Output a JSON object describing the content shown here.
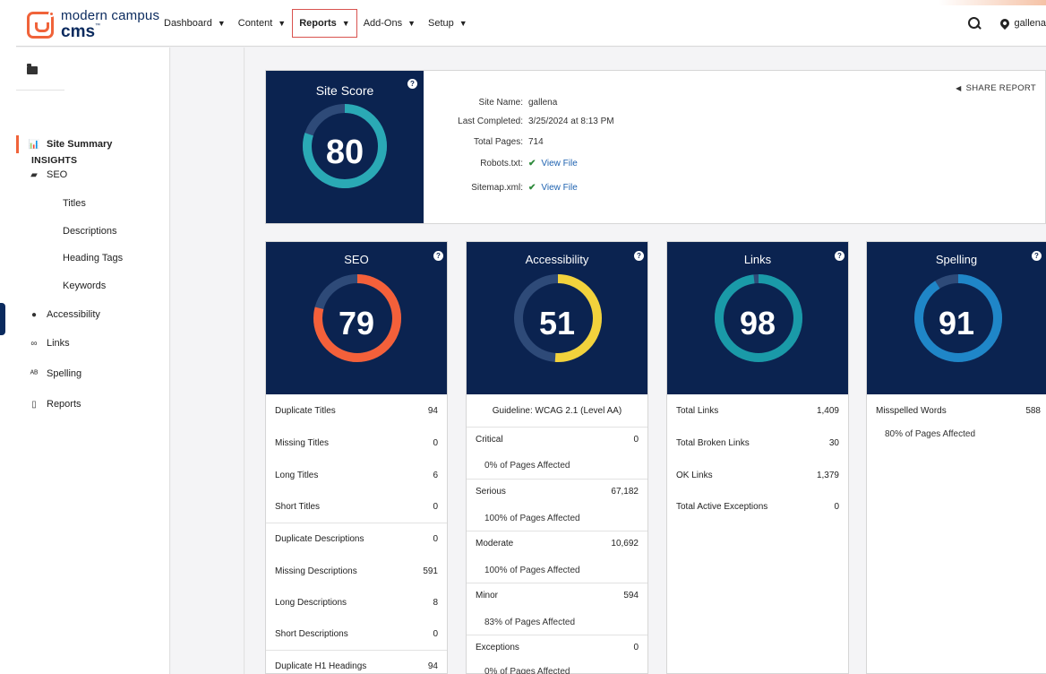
{
  "app": {
    "logo_line1": "modern campus",
    "logo_line2": "cms",
    "logo_tm": "™"
  },
  "nav": [
    {
      "label": "Dashboard",
      "active": false
    },
    {
      "label": "Content",
      "active": false
    },
    {
      "label": "Reports",
      "active": true
    },
    {
      "label": "Add-Ons",
      "active": false
    },
    {
      "label": "Setup",
      "active": false
    }
  ],
  "user": {
    "site": "gallena"
  },
  "sidebar": {
    "heading": "INSIGHTS",
    "items": [
      {
        "label": "Site Summary",
        "icon": "bar-chart-icon",
        "active": true
      },
      {
        "label": "SEO",
        "icon": "seo-icon",
        "active": false
      },
      {
        "label": "Accessibility",
        "icon": "accessibility-icon",
        "active": false
      },
      {
        "label": "Links",
        "icon": "link-icon",
        "active": false
      },
      {
        "label": "Spelling",
        "icon": "spelling-icon",
        "active": false
      },
      {
        "label": "Reports",
        "icon": "document-icon",
        "active": false
      }
    ],
    "seo_subitems": [
      "Titles",
      "Descriptions",
      "Heading Tags",
      "Keywords"
    ]
  },
  "site_score": {
    "title": "Site Score",
    "score": "80",
    "share_label": "SHARE REPORT",
    "info": {
      "site_name_label": "Site Name:",
      "site_name": "gallena",
      "last_completed_label": "Last Completed:",
      "last_completed": "3/25/2024 at 8:13 PM",
      "total_pages_label": "Total Pages:",
      "total_pages": "714",
      "robots_label": "Robots.txt:",
      "robots_link": "View File",
      "sitemap_label": "Sitemap.xml:",
      "sitemap_link": "View File"
    }
  },
  "colors": {
    "navy": "#0b2350",
    "site_score_ring": "#2aa9b5",
    "seo_ring": "#f4603a",
    "accessibility_ring": "#f2d23c",
    "links_ring": "#1a9aa8",
    "spelling_ring": "#1f86c8",
    "accent": "#f0633a"
  },
  "seo": {
    "title": "SEO",
    "score": "79",
    "rows": [
      {
        "label": "Duplicate Titles",
        "value": "94"
      },
      {
        "label": "Missing Titles",
        "value": "0"
      },
      {
        "label": "Long Titles",
        "value": "6"
      },
      {
        "label": "Short Titles",
        "value": "0"
      },
      {
        "label": "Duplicate Descriptions",
        "value": "0"
      },
      {
        "label": "Missing Descriptions",
        "value": "591"
      },
      {
        "label": "Long Descriptions",
        "value": "8"
      },
      {
        "label": "Short Descriptions",
        "value": "0"
      },
      {
        "label": "Duplicate H1 Headings",
        "value": "94"
      }
    ]
  },
  "accessibility": {
    "title": "Accessibility",
    "score": "51",
    "guideline": "Guideline: WCAG 2.1 (Level AA)",
    "rows": [
      {
        "label": "Critical",
        "value": "0",
        "sub": "0% of Pages Affected"
      },
      {
        "label": "Serious",
        "value": "67,182",
        "sub": "100% of Pages Affected"
      },
      {
        "label": "Moderate",
        "value": "10,692",
        "sub": "100% of Pages Affected"
      },
      {
        "label": "Minor",
        "value": "594",
        "sub": "83% of Pages Affected"
      },
      {
        "label": "Exceptions",
        "value": "0",
        "sub": "0% of Pages Affected"
      }
    ]
  },
  "links": {
    "title": "Links",
    "score": "98",
    "rows": [
      {
        "label": "Total Links",
        "value": "1,409"
      },
      {
        "label": "Total Broken Links",
        "value": "30"
      },
      {
        "label": "OK Links",
        "value": "1,379"
      },
      {
        "label": "Total Active Exceptions",
        "value": "0"
      }
    ]
  },
  "spelling": {
    "title": "Spelling",
    "score": "91",
    "rows": [
      {
        "label": "Misspelled Words",
        "value": "588",
        "sub": "80% of Pages Affected"
      }
    ]
  }
}
